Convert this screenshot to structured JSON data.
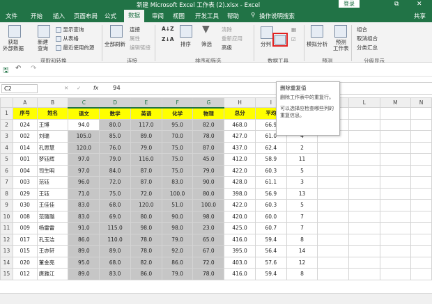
{
  "titlebar": {
    "title": "新建 Microsoft Excel 工作表 (2).xlsx  -  Excel",
    "login": "登录",
    "restore": "⧉",
    "close": "✕"
  },
  "tabs": [
    "文件",
    "开始",
    "插入",
    "页面布局",
    "公式",
    "数据",
    "审阅",
    "视图",
    "开发工具",
    "帮助",
    "操作说明搜索"
  ],
  "share_label": "共享",
  "ribbon": {
    "get_external": "获取\n外部数据",
    "new_query": "新建\n查询",
    "show_queries": "显示查询",
    "from_table": "从表格",
    "recent_sources": "最近使用的源",
    "group_get_transform": "获取和转换",
    "refresh_all": "全部刷新",
    "connections": "连接",
    "properties": "属性",
    "edit_links": "编辑链接",
    "group_connections": "连接",
    "sort_az": "A↓Z",
    "sort_za": "Z↓A",
    "sort": "排序",
    "filter": "筛选",
    "clear": "清除",
    "reapply": "重新应用",
    "advanced": "高级",
    "group_sort_filter": "排序和筛选",
    "split": "分列",
    "group_data_tools": "数据工具",
    "what_if": "模拟分析",
    "forecast_sheet": "预测\n工作表",
    "group_forecast": "预测",
    "group_btn": "组合",
    "ungroup_btn": "取消组合",
    "subtotal": "分类汇总",
    "group_outline": "分级显示"
  },
  "formula_bar": {
    "name_box": "C2",
    "fx": "fx",
    "value": "94"
  },
  "tooltip": {
    "title": "删除重复值",
    "line1": "删除工作表中的重复行。",
    "line2": "可以选择应检查哪些列的重复信息。"
  },
  "columns": [
    "A",
    "B",
    "C",
    "D",
    "E",
    "F",
    "G",
    "H",
    "I",
    "J",
    "K",
    "L",
    "M",
    "N"
  ],
  "header_row": [
    "序号",
    "姓名",
    "语文",
    "数学",
    "英语",
    "化学",
    "物理",
    "总分",
    "平均",
    "排名"
  ],
  "rows": [
    [
      "024",
      "王博",
      "94.0",
      "80.0",
      "117.0",
      "95.0",
      "82.0",
      "468.0",
      "66.9",
      "1"
    ],
    [
      "002",
      "刘瑞",
      "105.0",
      "85.0",
      "89.0",
      "70.0",
      "78.0",
      "427.0",
      "61.0",
      "4"
    ],
    [
      "014",
      "孔思慧",
      "120.0",
      "76.0",
      "79.0",
      "75.0",
      "87.0",
      "437.0",
      "62.4",
      "2"
    ],
    [
      "001",
      "梦钰辉",
      "97.0",
      "79.0",
      "116.0",
      "75.0",
      "45.0",
      "412.0",
      "58.9",
      "11"
    ],
    [
      "004",
      "司生明",
      "97.0",
      "84.0",
      "87.0",
      "75.0",
      "79.0",
      "422.0",
      "60.3",
      "5"
    ],
    [
      "003",
      "范钰",
      "96.0",
      "72.0",
      "87.0",
      "83.0",
      "90.0",
      "428.0",
      "61.1",
      "3"
    ],
    [
      "029",
      "王钰",
      "71.0",
      "75.0",
      "72.0",
      "100.0",
      "80.0",
      "398.0",
      "56.9",
      "13"
    ],
    [
      "030",
      "王佳佳",
      "83.0",
      "68.0",
      "120.0",
      "51.0",
      "100.0",
      "422.0",
      "60.3",
      "5"
    ],
    [
      "008",
      "范璐璐",
      "83.0",
      "69.0",
      "80.0",
      "90.0",
      "98.0",
      "420.0",
      "60.0",
      "7"
    ],
    [
      "009",
      "杨雷雷",
      "91.0",
      "115.0",
      "98.0",
      "98.0",
      "23.0",
      "425.0",
      "60.7",
      "7"
    ],
    [
      "017",
      "孔玉洁",
      "86.0",
      "110.0",
      "78.0",
      "79.0",
      "65.0",
      "416.0",
      "59.4",
      "8"
    ],
    [
      "015",
      "王亦轩",
      "89.0",
      "89.0",
      "78.0",
      "92.0",
      "67.0",
      "395.0",
      "56.4",
      "14"
    ],
    [
      "020",
      "董金亮",
      "95.0",
      "68.0",
      "82.0",
      "86.0",
      "72.0",
      "403.0",
      "57.6",
      "12"
    ],
    [
      "012",
      "唐雅江",
      "89.0",
      "83.0",
      "86.0",
      "79.0",
      "78.0",
      "416.0",
      "59.4",
      "8"
    ]
  ]
}
